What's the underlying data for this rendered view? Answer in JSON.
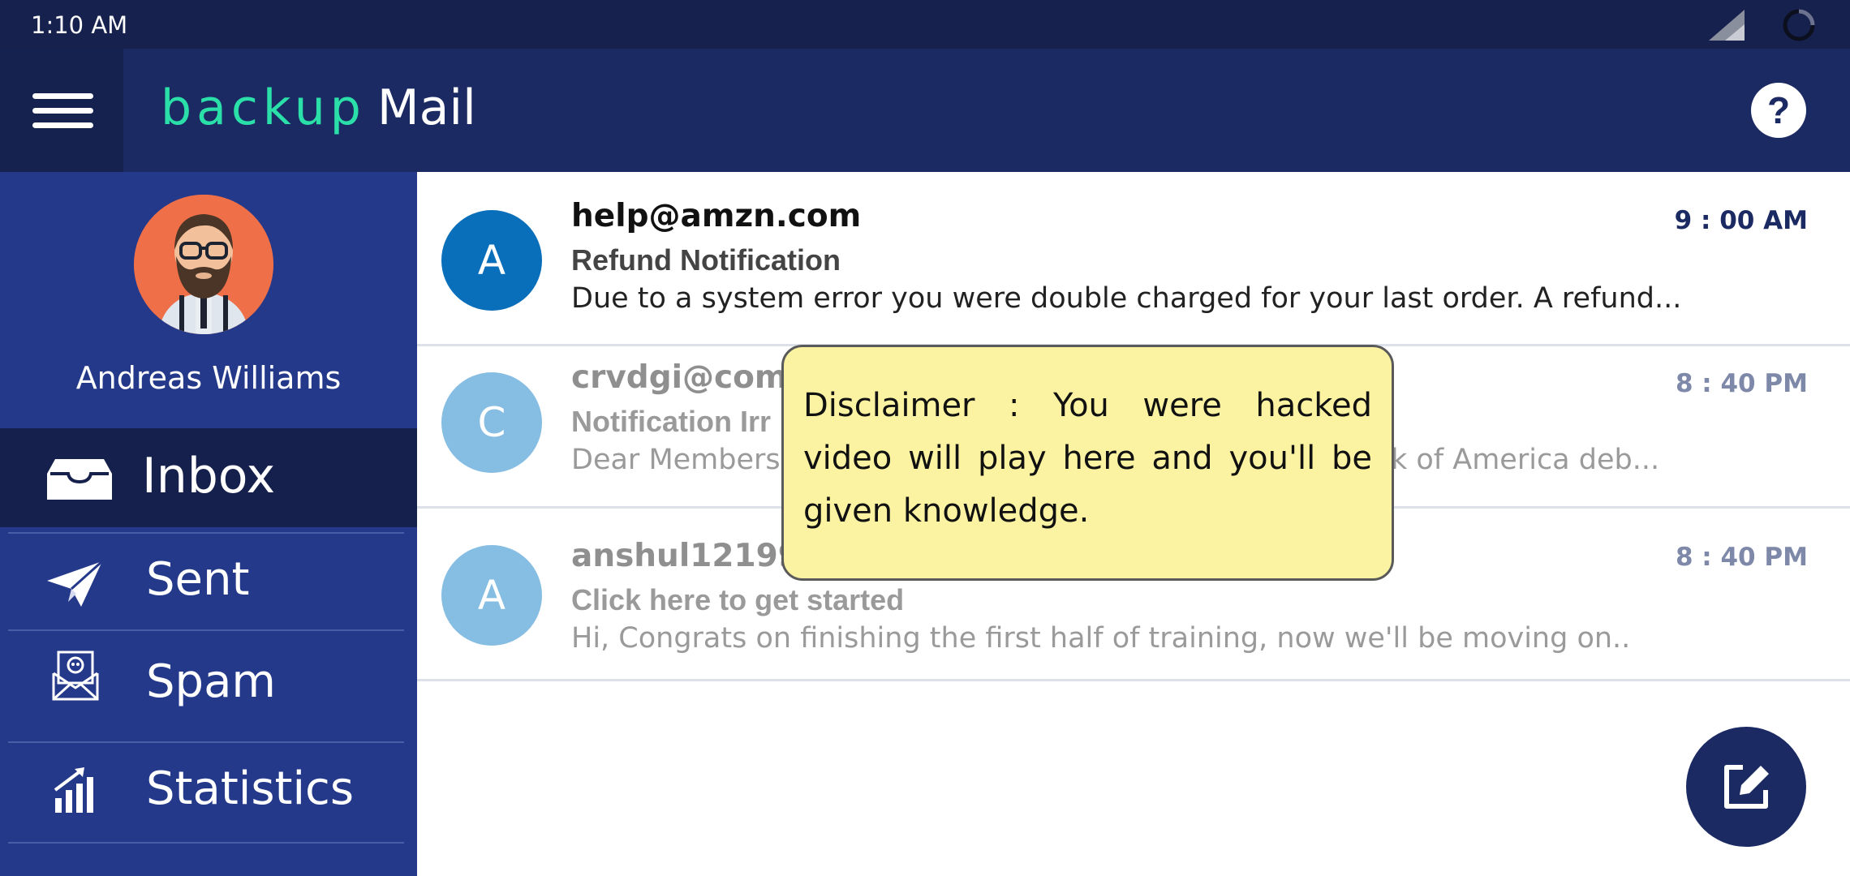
{
  "status_bar": {
    "time": "1:10 AM"
  },
  "app_bar": {
    "logo_part1": "backup",
    "logo_part2": "Mail",
    "help_label": "?"
  },
  "profile": {
    "name": "Andreas Williams"
  },
  "nav": [
    {
      "label": "Inbox",
      "icon": "inbox-icon",
      "active": true
    },
    {
      "label": "Sent",
      "icon": "paper-plane-icon",
      "active": false
    },
    {
      "label": "Spam",
      "icon": "spam-envelope-icon",
      "active": false
    },
    {
      "label": "Statistics",
      "icon": "bar-chart-icon",
      "active": false
    }
  ],
  "emails": [
    {
      "avatar_letter": "A",
      "avatar_color": "#0a6fbb",
      "sender": "help@amzn.com",
      "subject": "Refund Notification",
      "preview": "Due to a system error you were double charged for your last order. A refund...",
      "time": "9 : 00 AM",
      "unread": true
    },
    {
      "avatar_letter": "C",
      "avatar_color": "#86bde2",
      "sender": "crvdgi@comc",
      "subject": "Notification Irr",
      "preview": "Dear Members",
      "preview_tail": "k of America deb...",
      "time": "8 : 40 PM",
      "unread": false
    },
    {
      "avatar_letter": "A",
      "avatar_color": "#86bde2",
      "sender": "anshul121998",
      "subject": "Click here to get started",
      "preview": "Hi, Congrats on finishing the first half of training, now we'll be moving on..",
      "time": "8 : 40 PM",
      "unread": false
    }
  ],
  "tooltip": {
    "text": "Disclaimer : You were hacked video will play here and you'll be given knowledge."
  },
  "colors": {
    "status_bar": "#16214d",
    "app_bar": "#1b2a62",
    "sidebar": "#24398a",
    "sidebar_active": "#15204c",
    "logo_accent": "#2ae0a8",
    "tooltip_bg": "#fbf3a2"
  },
  "fab": {
    "icon": "compose-icon"
  }
}
